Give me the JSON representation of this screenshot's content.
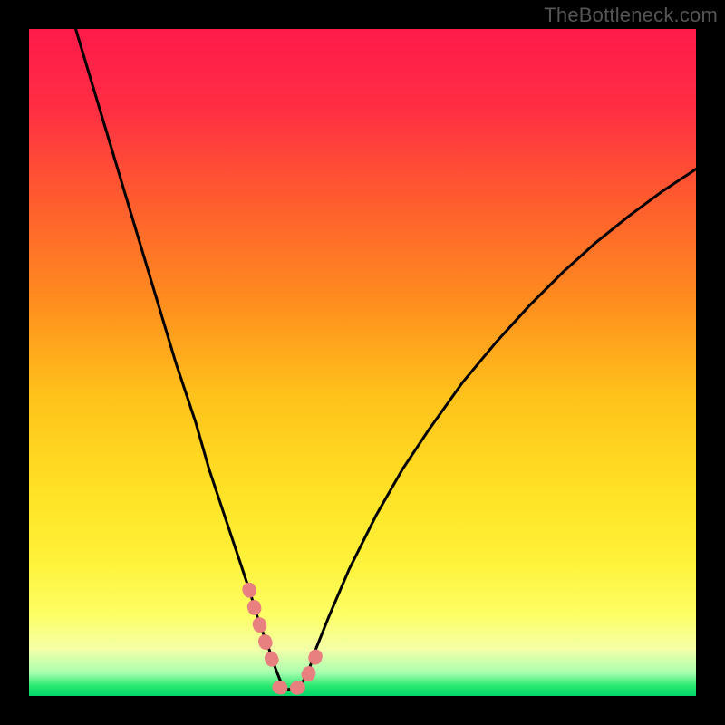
{
  "attribution": "TheBottleneck.com",
  "colors": {
    "frame": "#000000",
    "gradient_stops": [
      {
        "offset": 0.0,
        "color": "#ff1a4b"
      },
      {
        "offset": 0.12,
        "color": "#ff2e43"
      },
      {
        "offset": 0.25,
        "color": "#ff5a2f"
      },
      {
        "offset": 0.4,
        "color": "#ff8a1f"
      },
      {
        "offset": 0.55,
        "color": "#ffc21a"
      },
      {
        "offset": 0.7,
        "color": "#ffe326"
      },
      {
        "offset": 0.8,
        "color": "#fff23a"
      },
      {
        "offset": 0.88,
        "color": "#fdff66"
      },
      {
        "offset": 0.93,
        "color": "#f4ffa8"
      },
      {
        "offset": 0.965,
        "color": "#a8ffb0"
      },
      {
        "offset": 0.985,
        "color": "#28e86f"
      },
      {
        "offset": 1.0,
        "color": "#00d66a"
      }
    ],
    "curve": "#000000",
    "highlight": "#e98080"
  },
  "chart_data": {
    "type": "line",
    "title": "",
    "xlabel": "",
    "ylabel": "",
    "xlim": [
      0,
      100
    ],
    "ylim": [
      0,
      100
    ],
    "legend": false,
    "grid": false,
    "series": [
      {
        "name": "curve",
        "x": [
          7,
          10,
          13,
          16,
          19,
          22,
          25,
          27,
          29,
          31,
          33,
          34.5,
          36,
          37,
          37.8,
          38.5,
          39.2,
          40,
          41,
          42,
          43,
          45,
          48,
          52,
          56,
          60,
          65,
          70,
          75,
          80,
          85,
          90,
          95,
          100
        ],
        "y": [
          100,
          90,
          80,
          70,
          60,
          50,
          41,
          34,
          28,
          22,
          16,
          11,
          7,
          4,
          2,
          1,
          1,
          1,
          2,
          4,
          7,
          12,
          19,
          27,
          34,
          40,
          47,
          53,
          58.5,
          63.5,
          68,
          72,
          75.7,
          79
        ]
      }
    ],
    "highlight_segments": [
      {
        "x": [
          33.0,
          34.0,
          35.0,
          36.0,
          37.0
        ],
        "y": [
          16.0,
          12.5,
          9.3,
          6.5,
          4.0
        ]
      },
      {
        "x": [
          37.5,
          38.5,
          39.5,
          40.5,
          41.5,
          42.5,
          43.5
        ],
        "y": [
          1.3,
          1.0,
          1.0,
          1.3,
          2.5,
          4.5,
          7.5
        ]
      }
    ]
  }
}
